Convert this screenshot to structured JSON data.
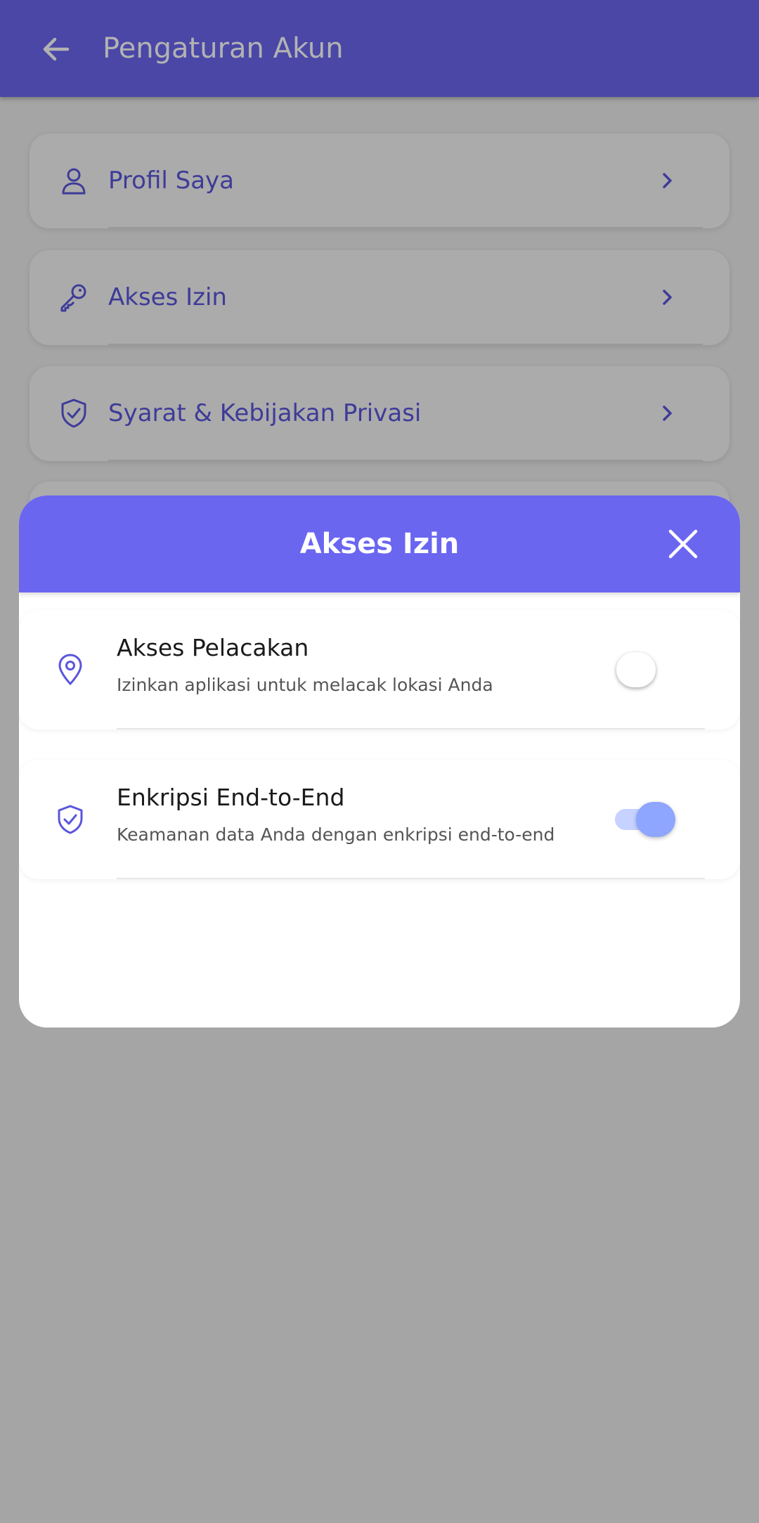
{
  "app_bar": {
    "title": "Pengaturan Akun",
    "back_icon": "arrow-left-icon"
  },
  "settings": {
    "items": [
      {
        "label": "Profil Saya",
        "icon": "user-icon"
      },
      {
        "label": "Akses Izin",
        "icon": "key-icon"
      },
      {
        "label": "Syarat & Kebijakan Privasi",
        "icon": "shield-check-icon"
      }
    ]
  },
  "dialog": {
    "title": "Akses Izin",
    "close_icon": "close-icon",
    "permissions": [
      {
        "title": "Akses Pelacakan",
        "description": "Izinkan aplikasi untuk melacak lokasi Anda",
        "icon": "location-pin-icon",
        "enabled": false
      },
      {
        "title": "Enkripsi End-to-End",
        "description": "Keamanan data Anda dengan enkripsi end-to-end",
        "icon": "shield-check-icon",
        "enabled": true
      }
    ]
  },
  "colors": {
    "primary": "#6a66f0",
    "accent_text": "#5a55dc",
    "toggle_on_thumb": "#8ea6ff",
    "toggle_on_track": "#c6d2ff"
  }
}
